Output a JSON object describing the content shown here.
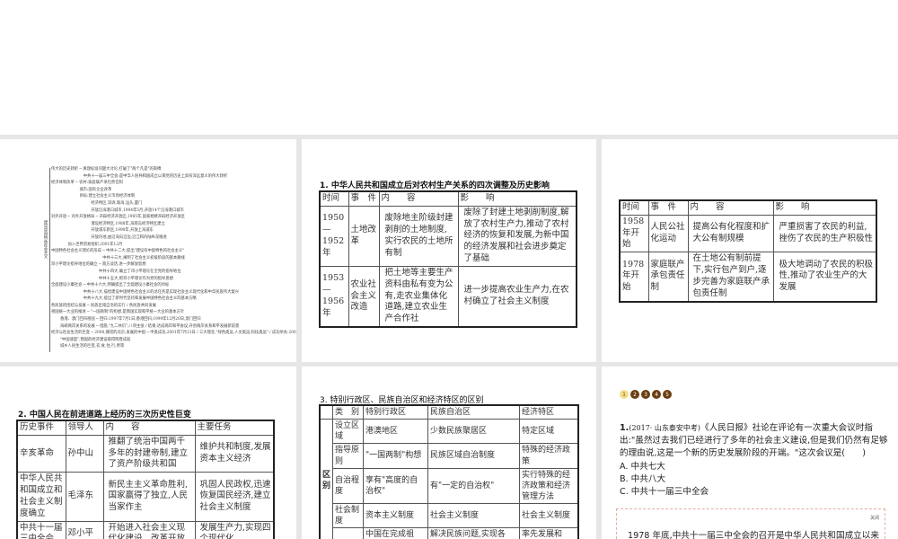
{
  "mindmap": {
    "root": "建设中国特色社会主义",
    "lines": [
      "伟大的历史转折 ─ 真理标准问题大讨论,打破了\"两个凡是\"的束缚",
      "　　　　　　　　 中共十一届三中全会:是中华人民共和国成立以来党的历史上具有深远意义的伟大转折",
      "经济体制改革 ─ 农村:家庭联产承包责任制",
      "　　　　　　　 城市:国有企业改革",
      "　　　　　　　 目标:建立社会主义市场经济体制",
      "　　　　　　　　　　 经济特区,深圳,珠海,汕头,厦门",
      "　　　　　　　　　　 开放沿海港口城市,1984年5月,开放14个沿海港口城市",
      "对外开放 ─ 对外开放格局 ─ 开辟经济开放区,1985年,国家相继开辟经济开放区",
      "　　　　　　　　　　 增设经济特区,1988年,海南岛经济特区建立",
      "　　　　　　　　　　 开放浦东新区,1990年,开放上海浦东",
      "　　　　　　　　　　 开放内地,由沿海向沿边,沿江和内陆纵深推进",
      "　　　　 加入世界贸易组织,2001年12月",
      "中国特色社会主义理论的形成 ─ 中共十二大,提出\"建设有中国特色的社会主义\"",
      "　　　　　　　　　　　　　 中共十三大,阐明了社会主义初级阶段的基本路线",
      "邓小平理论指导地位的确立 ─ 南方谈话,进一步解放思想",
      "　　　　　　　　　　　　 中共十四大,确立了邓小平理论在全党的指导地位",
      "　　　　　　　　　　　　 中共十五大,把邓小平理论作为党的指导思想",
      "全面建设小康社会 ─ 中共十六大,明确提出了全面建设小康社会的目标",
      "　　　　　　　　 中共十八大,描绘建设中国特色社会主义的总任务是实现社会主义现代化和中华民族伟大复兴",
      "　　　　　　　　 中共十九大,提出了新时代坚持和发展中国特色社会主义的基本方略",
      "各民族的团结与发展 ─ 民族区域自治的实行 / 各民族共同发展",
      "祖国统一大业的推进 ─ \"一国两制\"的构想,是我国实现和平统一大业的基本方针",
      "　　 香港、澳门回归祖国 ─ 回归:1997年7月1日,香港回归;1999年12月20日,澳门回归",
      "　　 海峡两岸关系的发展 ─ 措施,\"九二共识\",八项主张 / 结果,达成两岸和平协议,开创两岸关系和平发展新前景",
      "经济与社会生活的巨变 ─ 2008,挪诺的北京,发展的中国 ─ 申奥成功,2001年7月13日 / 三大理念,\"绿色奥运,人文奥运,科技奥运\" / 成功举办,2008年8月,第29届夏季奥运会在北京成功举办",
      "　　 \"中国速度\",我国的经济建设取得辉煌成就",
      "　　 城乡人民生活的巨变,衣,食,住,行,用等"
    ]
  },
  "slide1": {
    "title": "1. 中华人民共和国成立后对农村生产关系的四次调整及历史影响",
    "headers": [
      "时间",
      "事　件",
      "内　　容",
      "影　　响"
    ],
    "rows": [
      [
        "1950—1952年",
        "土地改革",
        "废除地主阶级封建剥削的土地制度,实行农民的土地所有制",
        "废除了封建土地剥削制度,解放了农村生产力,推动了农村经济的恢复和发展,为新中国的经济发展和社会进步奠定了基础"
      ],
      [
        "1953—1956年",
        "农业社会主义改造",
        "把土地等主要生产资料由私有变为公有,走农业集体化道路,建立农业生产合作社",
        "进一步提高农业生产力,在农村确立了社会主义制度"
      ]
    ]
  },
  "slide2": {
    "headers": [
      "时间",
      "事　件",
      "内　　容",
      "影　　响"
    ],
    "rows": [
      [
        "1958年开始",
        "人民公社化运动",
        "提高公有化程度和扩大公有制规模",
        "严重损害了农民的利益,挫伤了农民的生产积极性"
      ],
      [
        "1978年开始",
        "家庭联产承包责任制",
        "在土地公有制前提下,实行包产到户,逐步完善为家庭联产承包责任制",
        "极大地调动了农民的积极性,推动了农业生产的大发展"
      ]
    ]
  },
  "slide3": {
    "title": "2. 中国人民在前进道路上经历的三次历史性巨变",
    "headers": [
      "历史事件",
      "领导人",
      "内　　容",
      "主要任务"
    ],
    "rows": [
      [
        "辛亥革命",
        "孙中山",
        "推翻了统治中国两千多年的封建帝制,建立了资产阶级共和国",
        "维护共和制度,发展资本主义经济"
      ],
      [
        "中华人民共和国成立和社会主义制度确立",
        "毛泽东",
        "新民主主义革命胜利,国家赢得了独立,人民当家作主",
        "巩固人民政权,迅速恢复国民经济,建立社会主义制度"
      ],
      [
        "中共十一届三中全会",
        "邓小平",
        "开始进入社会主义现代化建设、改革开放",
        "发展生产力,实现四个现代化"
      ]
    ]
  },
  "slide4": {
    "title": "3. 特别行政区、民族自治区和经济特区的区别",
    "side_label": "区别",
    "headers": [
      "类　别",
      "特别行政区",
      "民族自治区",
      "经济特区"
    ],
    "rows": [
      [
        "设立区域",
        "港澳地区",
        "少数民族聚居区",
        "特定区域"
      ],
      [
        "指导原则",
        "\"一国两制\"构想",
        "民族区域自治制度",
        "特殊的经济政策"
      ],
      [
        "自治程度",
        "享有\"高度的自治权\"",
        "有\"一定的自治权\"",
        "实行特殊的经济政策和经济管理方法"
      ],
      [
        "社会制度",
        "资本主义制度",
        "社会主义制度",
        "社会主义制度"
      ],
      [
        "",
        "中国在完成祖",
        "解决民族问题,实现各",
        "率先发展和"
      ]
    ]
  },
  "slide5": {
    "pager": [
      "1",
      "2",
      "3",
      "4",
      "5"
    ],
    "active_page": 1,
    "question_num": "1.",
    "question_source": "(2017· 山东泰安中考)",
    "question_text": "《人民日报》社论在评论有一次重大会议时指出:\"虽然过去我们已经进行了多年的社会主义建设,但是我们仍然有足够的理由说,这是一个新的历史发展阶段的开端。\"这次会议是(　　)",
    "options": [
      "A. 中共七大",
      "B. 中共八大",
      "C. 中共十一届三中全会"
    ],
    "popup_close": "关闭",
    "answer_text": "1978 年底,中共十一届三中全会的召开是中华人民共和国成立以来"
  }
}
